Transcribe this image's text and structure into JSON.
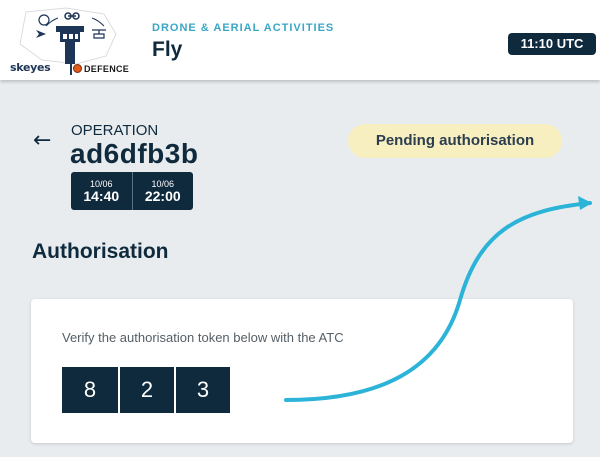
{
  "header": {
    "logo": {
      "brand": "skeyes",
      "partner": "DEFENCE"
    },
    "subtitle": "DRONE & AERIAL ACTIVITIES",
    "title": "Fly",
    "utc_time": "11:10 UTC"
  },
  "operation": {
    "label": "OPERATION",
    "id": "ad6dfb3b",
    "start": {
      "date": "10/06",
      "time": "14:40"
    },
    "end": {
      "date": "10/06",
      "time": "22:00"
    },
    "status": "Pending authorisation"
  },
  "authorisation": {
    "title": "Authorisation",
    "instruction": "Verify the authorisation token below with the ATC",
    "token": [
      "8",
      "2",
      "3"
    ]
  },
  "colors": {
    "primary_dark": "#0f2a3d",
    "accent_cyan": "#3aa6c6",
    "arrow": "#2bb3d8",
    "pending_bg": "#f7efc0",
    "page_bg": "#e8ecef"
  }
}
